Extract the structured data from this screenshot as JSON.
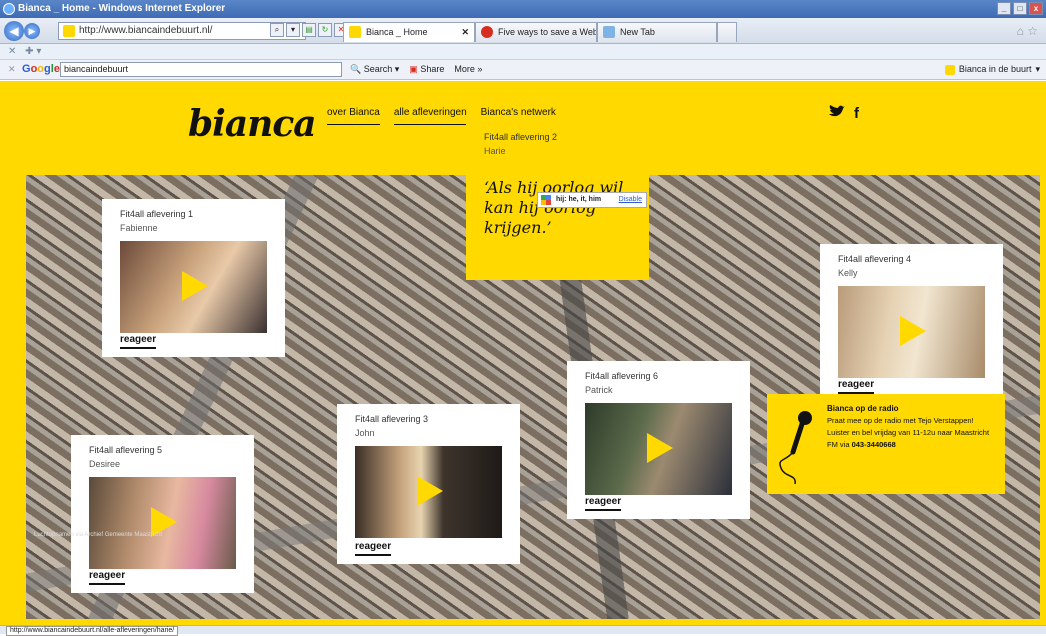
{
  "window": {
    "title": "Bianca _ Home - Windows Internet Explorer"
  },
  "browser": {
    "address": "http://www.biancaindebuurt.nl/",
    "tabs": [
      {
        "label": "Bianca _ Home",
        "color": "#ffd800"
      },
      {
        "label": "Five ways to save a Web page ...",
        "color": "#d62d20"
      },
      {
        "label": "New Tab",
        "color": "#7fb2e5"
      }
    ],
    "google": {
      "search_value": "biancaindebuurt",
      "search_label": "Search",
      "share_label": "Share",
      "more_label": "More »",
      "favorite_label": "Bianca in de buurt"
    }
  },
  "site": {
    "logo": "bianca",
    "menu": [
      "over Bianca",
      "alle afleveringen",
      "Bianca's netwerk"
    ],
    "social": {
      "twitter": "twitter-icon",
      "facebook": "f"
    },
    "accent": "#ffd900"
  },
  "cards": [
    {
      "title": "Fit4all aflevering 1",
      "name": "Fabienne",
      "reageer": "reageer"
    },
    {
      "title": "Fit4all aflevering 3",
      "name": "John",
      "reageer": "reageer"
    },
    {
      "title": "Fit4all aflevering 4",
      "name": "Kelly",
      "reageer": "reageer"
    },
    {
      "title": "Fit4all aflevering 5",
      "name": "Desiree",
      "reageer": "reageer"
    },
    {
      "title": "Fit4all aflevering 6",
      "name": "Patrick",
      "reageer": "reageer"
    }
  ],
  "quote_card": {
    "title": "Fit4all aflevering 2",
    "name": "Harie",
    "quote": "‘Als hij oorlog wil kan hij oorlog krijgen.’"
  },
  "dictionary_popup": {
    "text": "hij: he, it, him",
    "disable": "Disable"
  },
  "radio": {
    "title": "Bianca op de radio",
    "body": "Praat mee op de radio met Tejo Verstappen! Luister en bel vrijdag van 11-12u naar Maastricht FM via",
    "phone": "043-3440668"
  },
  "map_credit": "Luchtopnamen via Archief Gemeente Maastricht",
  "status_url": "http://www.biancaindebuurt.nl/alle-afleveringen/harie/"
}
